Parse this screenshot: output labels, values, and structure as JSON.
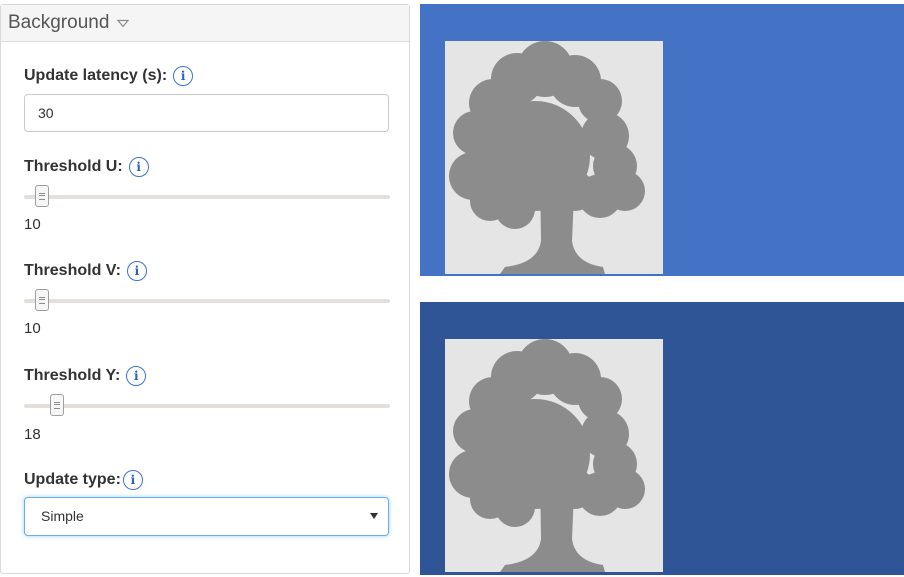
{
  "panel": {
    "title": "Background",
    "caret_icon": "chevron-down-icon"
  },
  "fields": {
    "latency": {
      "label": "Update latency (s):",
      "value": "30",
      "info_icon": "i"
    },
    "threshold_u": {
      "label": "Threshold U:",
      "value": "10",
      "level_percent": 5,
      "info_icon": "i"
    },
    "threshold_v": {
      "label": "Threshold V:",
      "value": "10",
      "level_percent": 5,
      "info_icon": "i"
    },
    "threshold_y": {
      "label": "Threshold Y:",
      "value": "18",
      "level_percent": 9,
      "info_icon": "i"
    },
    "update_type": {
      "label": "Update type:",
      "selected": "Simple",
      "info_icon": "i"
    }
  },
  "colors": {
    "top_video_background": "#4472c4",
    "bottom_video_background": "#2f5597",
    "tree_color": "#8c8c8c",
    "tree_frame_color": "#e5e5e5",
    "info_icon_color": "#3a72d8",
    "focus_border": "#66afe9"
  },
  "icons": {
    "info": "info-circle-icon",
    "tree": "tree-icon",
    "select_caret": "caret-down-icon"
  }
}
